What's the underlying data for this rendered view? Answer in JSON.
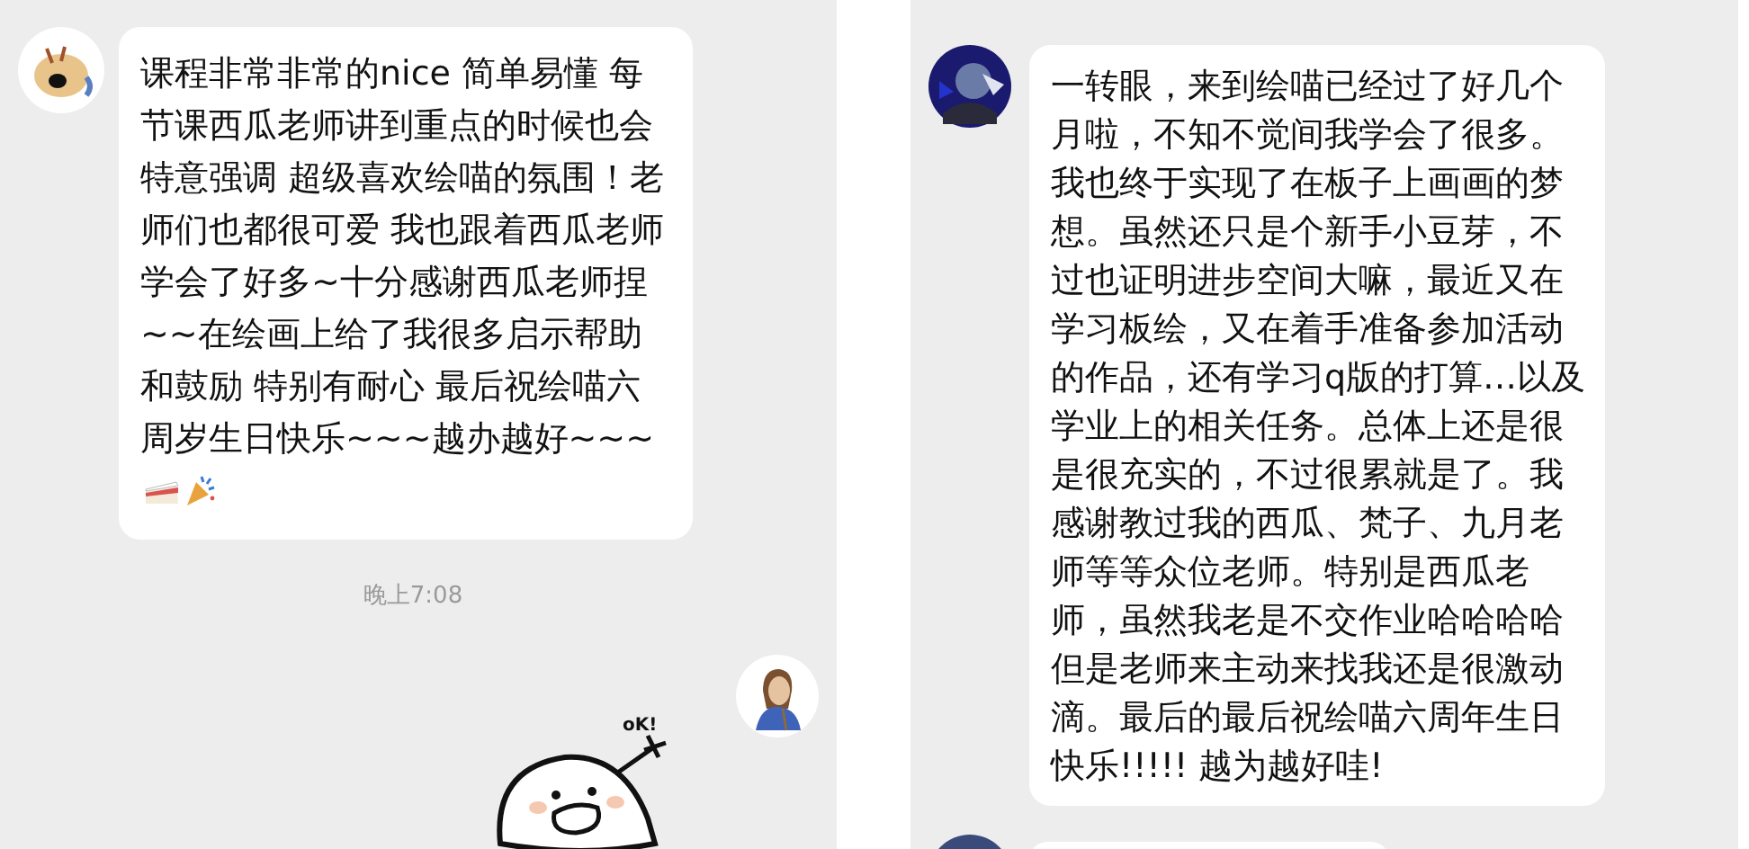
{
  "left_chat": {
    "message": {
      "text": "课程非常非常的nice 简单易懂 每节课西瓜老师讲到重点的时候也会特意强调 超级喜欢绘喵的氛围！老师们也都很可爱 我也跟着西瓜老师学会了好多~十分感谢西瓜老师捏~~在绘画上给了我很多启示帮助和鼓励 特别有耐心 最后祝绘喵六周岁生日快乐~~~越办越好~~~"
    },
    "timestamp": "晚上7:08",
    "sticker": {
      "caption": "oK!"
    }
  },
  "right_chat": {
    "message": {
      "text": "一转眼，来到绘喵已经过了好几个月啦，不知不觉间我学会了很多。我也终于实现了在板子上画画的梦想。虽然还只是个新手小豆芽，不过也证明进步空间大嘛，最近又在学习板绘，又在着手准备参加活动的作品，还有学习q版的打算…以及学业上的相关任务。总体上还是很是很充实的，不过很累就是了。我感谢教过我的西瓜、梵子、九月老师等等众位老师。特别是西瓜老师，虽然我老是不交作业哈哈哈哈但是老师来主动来找我还是很激动滴。最后的最后祝绘喵六周年生日快乐!!!!! 越为越好哇!"
    }
  }
}
